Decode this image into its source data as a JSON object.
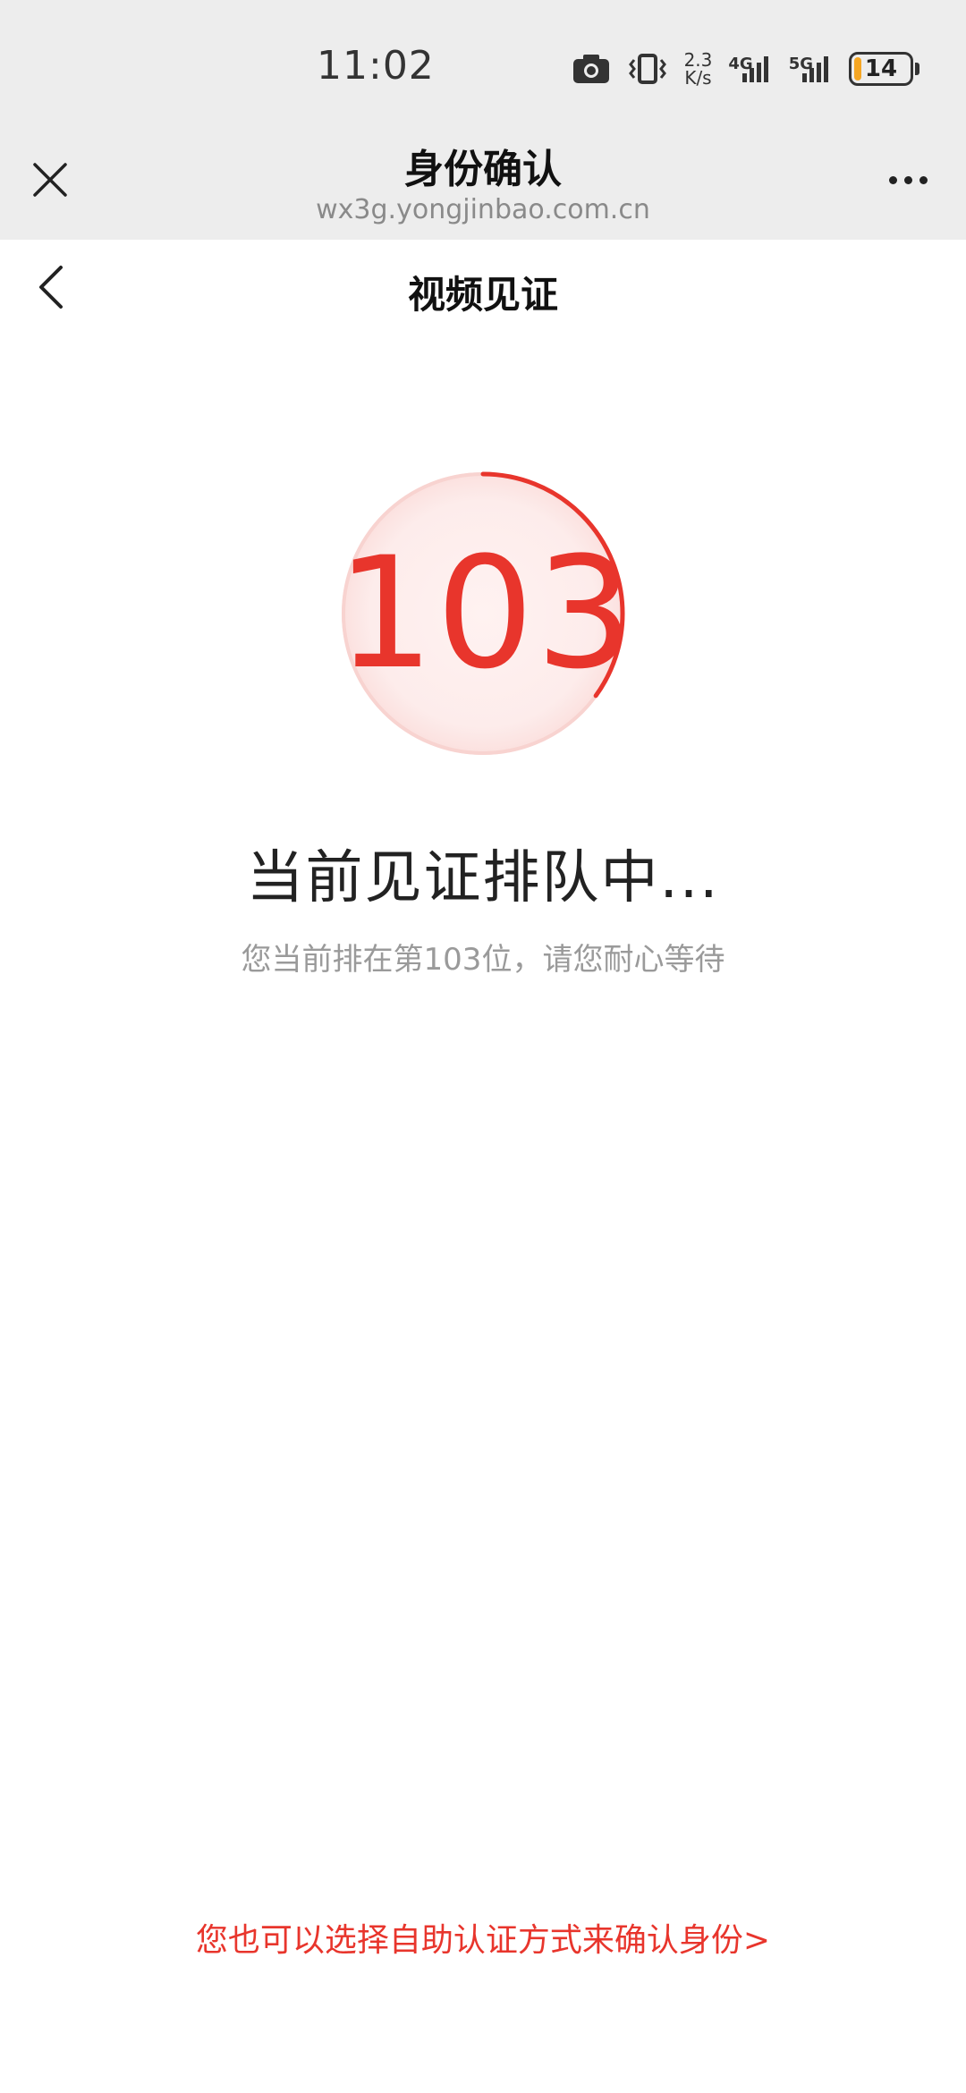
{
  "status_bar": {
    "time": "11:02",
    "speed_value": "2.3",
    "speed_unit": "K/s",
    "net_4g": "4G",
    "net_5g": "5G",
    "battery_level": "14",
    "battery_fraction": 0.14,
    "icons": [
      "camera-icon",
      "vibrate-icon",
      "signal-4g-icon",
      "signal-5g-icon",
      "battery-icon"
    ]
  },
  "browser_header": {
    "title": "身份确认",
    "url": "wx3g.yongjinbao.com.cn",
    "close_icon": "close-icon",
    "more_icon": "more-icon"
  },
  "page_nav": {
    "title": "视频见证",
    "back_icon": "chevron-left-icon"
  },
  "queue": {
    "position": "103",
    "status_text": "当前见证排队中...",
    "hint_text": "您当前排在第103位，请您耐心等待",
    "progress_fraction": 0.35
  },
  "footer": {
    "self_auth_link": "您也可以选择自助认证方式来确认身份>"
  },
  "colors": {
    "accent": "#e8352c",
    "header_bg": "#ededed",
    "battery": "#f5a623"
  }
}
